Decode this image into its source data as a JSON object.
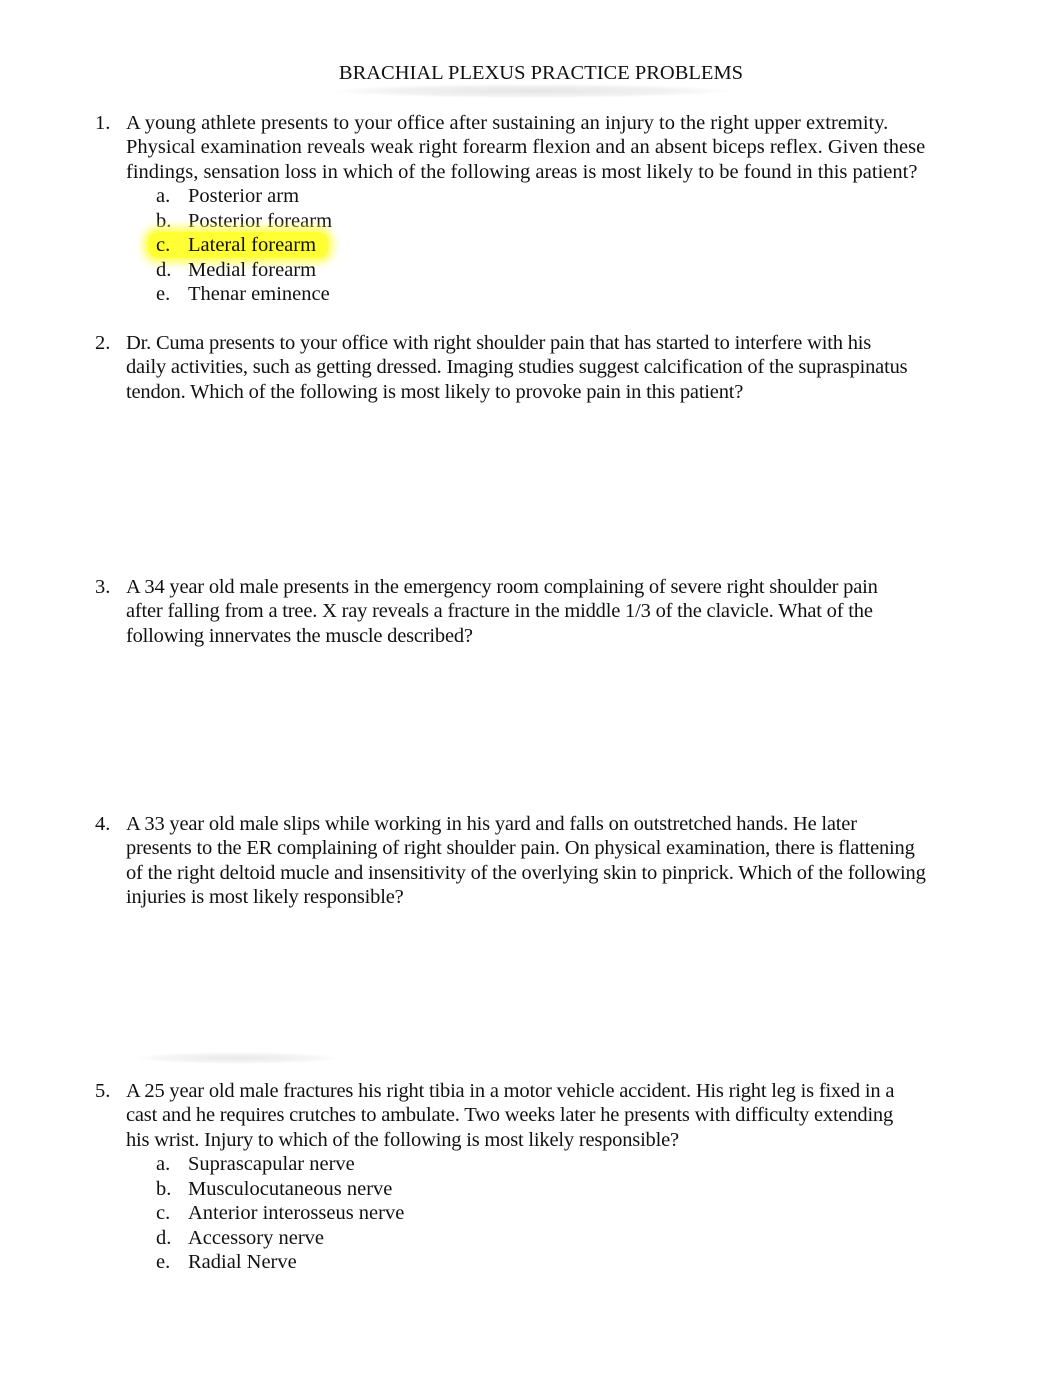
{
  "document": {
    "title": "BRACHIAL PLEXUS PRACTICE PROBLEMS",
    "highlight_color": "#ffff33"
  },
  "questions": [
    {
      "number": "1.",
      "lines": [
        "A young athlete presents to your office after sustaining an injury to the right upper extremity.",
        "Physical examination reveals weak right forearm flexion and an absent biceps reflex. Given these",
        "findings, sensation loss in which of the following areas is most likely to be found in this patient?"
      ],
      "options": [
        {
          "letter": "a.",
          "text": "Posterior arm",
          "highlighted": false
        },
        {
          "letter": "b.",
          "text": "Posterior forearm",
          "highlighted": false
        },
        {
          "letter": "c.",
          "text": "Lateral forearm",
          "highlighted": true
        },
        {
          "letter": "d.",
          "text": "Medial forearm",
          "highlighted": false
        },
        {
          "letter": "e.",
          "text": "Thenar eminence",
          "highlighted": false
        }
      ]
    },
    {
      "number": "2.",
      "lines": [
        "Dr. Cuma presents to your office with right shoulder pain that has started to interfere with his",
        "daily activities, such as getting dressed. Imaging studies suggest calcification of the supraspinatus",
        "tendon. Which of the following is most likely to provoke pain in this patient?"
      ],
      "options": []
    },
    {
      "number": "3.",
      "lines": [
        "A 34 year old male presents in the emergency room complaining of severe right shoulder pain",
        "after falling from a tree. X ray reveals a fracture in the middle 1/3 of the clavicle. What of the",
        "following innervates the muscle described?"
      ],
      "options": []
    },
    {
      "number": "4.",
      "lines": [
        "A 33 year old male slips while working in his yard and falls on outstretched hands. He later",
        "presents to the ER complaining of right shoulder pain. On physical examination, there is flattening",
        "of the right deltoid mucle and insensitivity of the overlying skin to pinprick. Which of the following",
        "injuries is most likely responsible?"
      ],
      "options": []
    },
    {
      "number": "5.",
      "lines": [
        "A 25 year old male fractures his right tibia in a motor vehicle accident. His right leg is fixed in a",
        "cast and he requires crutches to ambulate. Two weeks later he presents with difficulty extending",
        "his wrist. Injury to which of the following is most likely responsible?"
      ],
      "options": [
        {
          "letter": "a.",
          "text": "Suprascapular nerve",
          "highlighted": false
        },
        {
          "letter": "b.",
          "text": "Musculocutaneous nerve",
          "highlighted": false
        },
        {
          "letter": "c.",
          "text": "Anterior interosseus nerve",
          "highlighted": false
        },
        {
          "letter": "d.",
          "text": "Accessory nerve",
          "highlighted": false
        },
        {
          "letter": "e.",
          "text": "Radial Nerve",
          "highlighted": false
        }
      ]
    }
  ]
}
